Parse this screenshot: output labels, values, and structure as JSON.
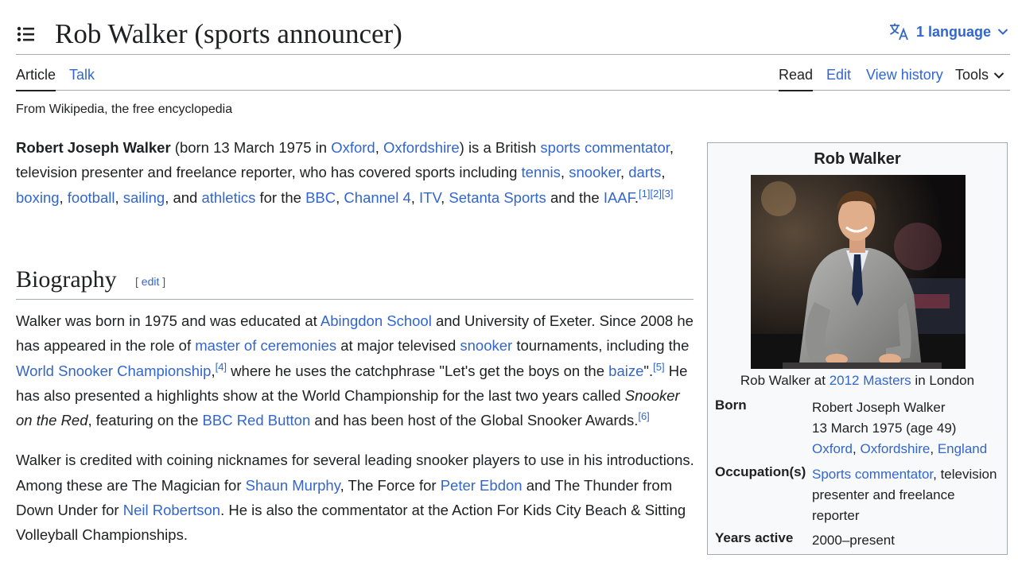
{
  "header": {
    "title": "Rob Walker (sports announcer)",
    "language_label": "1 language"
  },
  "tabs": {
    "article": "Article",
    "talk": "Talk",
    "read": "Read",
    "edit": "Edit",
    "view_history": "View history",
    "tools": "Tools"
  },
  "tagline": "From Wikipedia, the free encyclopedia",
  "lead": {
    "name": "Robert Joseph Walker",
    "t1": " (born 13 March 1975 in ",
    "l_oxford": "Oxford",
    "t2": ", ",
    "l_oxfordshire": "Oxfordshire",
    "t3": ") is a British ",
    "l_sports_commentator": "sports commentator",
    "t4": ", television presenter and freelance reporter, who has covered sports including ",
    "l_tennis": "tennis",
    "l_snooker": "snooker",
    "l_darts": "darts",
    "l_boxing": "boxing",
    "l_football": "football",
    "l_sailing": "sailing",
    "t5": ", and ",
    "l_athletics": "athletics",
    "t6": " for the ",
    "l_bbc": "BBC",
    "l_channel4": "Channel 4",
    "l_itv": "ITV",
    "l_setanta": "Setanta Sports",
    "t7": " and the ",
    "l_iaaf": "IAAF",
    "ref1": "[1]",
    "ref2": "[2]",
    "ref3": "[3]",
    "comma": ", ",
    "period": "."
  },
  "biography": {
    "heading": "Biography",
    "edit_open": "[ ",
    "edit": "edit",
    "edit_close": " ]",
    "p1": {
      "t1": "Walker was born in 1975 and was educated at ",
      "l_abingdon": "Abingdon School",
      "t2": " and University of Exeter. Since 2008 he has appeared in the role of ",
      "l_mc": "master of ceremonies",
      "t3": " at major televised ",
      "l_snooker": "snooker",
      "t4": " tournaments, including the ",
      "l_wsc": "World Snooker Championship",
      "t5": ",",
      "ref4": "[4]",
      "t6": " where he uses the catchphrase \"Let's get the boys on the ",
      "l_baize": "baize",
      "t7": "\".",
      "ref5": "[5]",
      "t8": " He has also presented a highlights show at the World Championship for the last two years called ",
      "show": "Snooker on the Red",
      "t9": ", featuring on the ",
      "l_red_button": "BBC Red Button",
      "t10": " and has been host of the Global Snooker Awards.",
      "ref6": "[6]"
    },
    "p2": {
      "t1": "Walker is credited with coining nicknames for several leading snooker players to use in his introductions. Among these are The Magician for ",
      "l_murphy": "Shaun Murphy",
      "t2": ", The Force for ",
      "l_ebdon": "Peter Ebdon",
      "t3": " and The Thunder from Down Under for ",
      "l_robertson": "Neil Robertson",
      "t4": ". He is also the commentator at the Action For Kids City Beach & Sitting Volleyball Championships."
    }
  },
  "infobox": {
    "title": "Rob Walker",
    "caption_t1": "Rob Walker at ",
    "caption_link": "2012 Masters",
    "caption_t2": " in London",
    "born_label": "Born",
    "born_name": "Robert Joseph Walker",
    "born_date": "13 March 1975 (age 49)",
    "born_place1": "Oxford",
    "born_place2": "Oxfordshire",
    "born_place3": "England",
    "sep": ", ",
    "occupation_label": "Occupation(s)",
    "occupation_link": "Sports commentator",
    "occupation_rest": ", television presenter and freelance reporter",
    "years_label": "Years active",
    "years_value": "2000–present"
  },
  "colors": {
    "link": "#3366cc",
    "text": "#202122",
    "border": "#a2a9b1",
    "infobox_bg": "#f8f9fa"
  },
  "icons": {
    "toc": "list-bullet-icon",
    "language": "translate-icon",
    "dropdown": "chevron-down-icon"
  }
}
